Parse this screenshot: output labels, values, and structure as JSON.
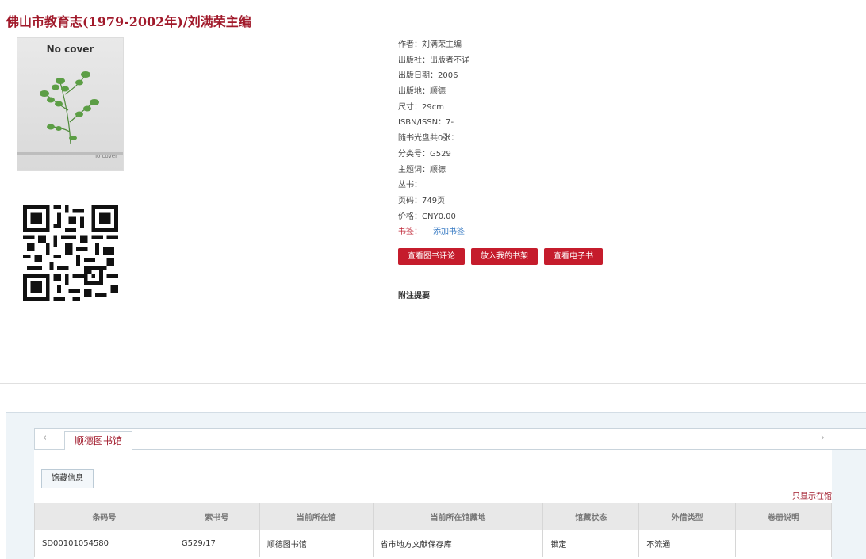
{
  "book": {
    "title": "佛山市教育志(1979-2002年)",
    "separator": "/",
    "responsibility": "刘满荣主编"
  },
  "cover": {
    "title": "No cover",
    "footer": "no cover"
  },
  "qr_icon": "qr-code-icon",
  "metadata": [
    {
      "label": "作者：",
      "value": "刘满荣主编"
    },
    {
      "label": "出版社：",
      "value": "出版者不详"
    },
    {
      "label": "出版日期：",
      "value": "2006"
    },
    {
      "label": "出版地：",
      "value": "顺德"
    },
    {
      "label": "尺寸：",
      "value": "29cm"
    },
    {
      "label": "ISBN/ISSN：",
      "value": "7-"
    },
    {
      "label": "随书光盘共",
      "value": "0张："
    },
    {
      "label": "分类号：",
      "value": "G529"
    },
    {
      "label": "主题词：",
      "value": "顺德"
    },
    {
      "label": "丛书：",
      "value": ""
    },
    {
      "label": "页码：",
      "value": "749页"
    },
    {
      "label": "价格：",
      "value": "CNY0.00"
    }
  ],
  "bookmark": {
    "label": "书签：",
    "link": "添加书签"
  },
  "actions": {
    "view_reviews": "查看图书评论",
    "add_to_shelf": "放入我的书架",
    "view_ebook": "查看电子书"
  },
  "notes_heading": "附注提要",
  "library_tabs": {
    "prev_icon": "chevron-left-icon",
    "next_icon": "chevron-right-icon",
    "active": "顺德图书馆"
  },
  "holdings": {
    "subtab": "馆藏信息",
    "filter_link": "只显示在馆",
    "columns": [
      "条码号",
      "索书号",
      "当前所在馆",
      "当前所在馆藏地",
      "馆藏状态",
      "外借类型",
      "卷册说明"
    ],
    "rows": [
      [
        "SD00101054580",
        "G529/17",
        "顺德图书馆",
        "省市地方文献保存库",
        "锁定",
        "不流通",
        ""
      ]
    ]
  },
  "colors": {
    "brand": "#a11a2b",
    "button": "#c51c2c",
    "link": "#3a7cc4"
  }
}
